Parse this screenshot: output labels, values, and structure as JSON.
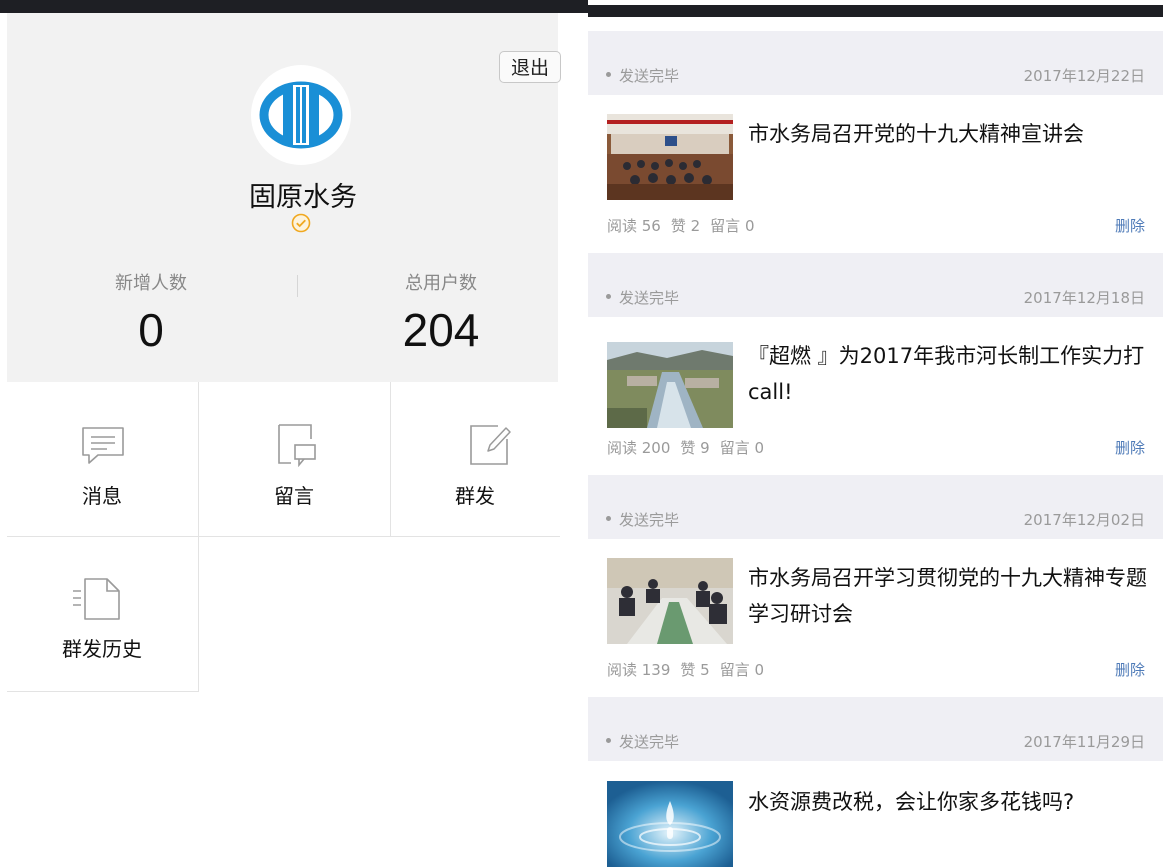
{
  "left": {
    "logout_label": "退出",
    "account_name": "固原水务",
    "stats": {
      "new_users_label": "新增人数",
      "new_users_value": "0",
      "total_users_label": "总用户数",
      "total_users_value": "204"
    },
    "menu": [
      {
        "label": "消息",
        "icon": "message-icon"
      },
      {
        "label": "留言",
        "icon": "comment-icon"
      },
      {
        "label": "群发",
        "icon": "compose-icon"
      },
      {
        "label": "群发历史",
        "icon": "history-icon"
      }
    ]
  },
  "right": {
    "articles": [
      {
        "status": "发送完毕",
        "date": "2017年12月22日",
        "title": "市水务局召开党的十九大精神宣讲会",
        "reads": "阅读 56",
        "likes": "赞 2",
        "comments": "留言 0",
        "delete_label": "删除",
        "thumb": "meeting-hall"
      },
      {
        "status": "发送完毕",
        "date": "2017年12月18日",
        "title": "『超燃 』为2017年我市河长制工作实力打call!",
        "reads": "阅读 200",
        "likes": "赞 9",
        "comments": "留言 0",
        "delete_label": "删除",
        "thumb": "river-aerial"
      },
      {
        "status": "发送完毕",
        "date": "2017年12月02日",
        "title": "市水务局召开学习贯彻党的十九大精神专题学习研讨会",
        "reads": "阅读 139",
        "likes": "赞 5",
        "comments": "留言 0",
        "delete_label": "删除",
        "thumb": "conference-table"
      },
      {
        "status": "发送完毕",
        "date": "2017年11月29日",
        "title": "水资源费改税，会让你家多花钱吗?",
        "thumb": "water-drop"
      }
    ]
  },
  "colors": {
    "accent_link": "#4f7bb8",
    "logo_blue": "#1a8fd6",
    "verified": "#f0a820",
    "status_bg": "#efeff4"
  }
}
